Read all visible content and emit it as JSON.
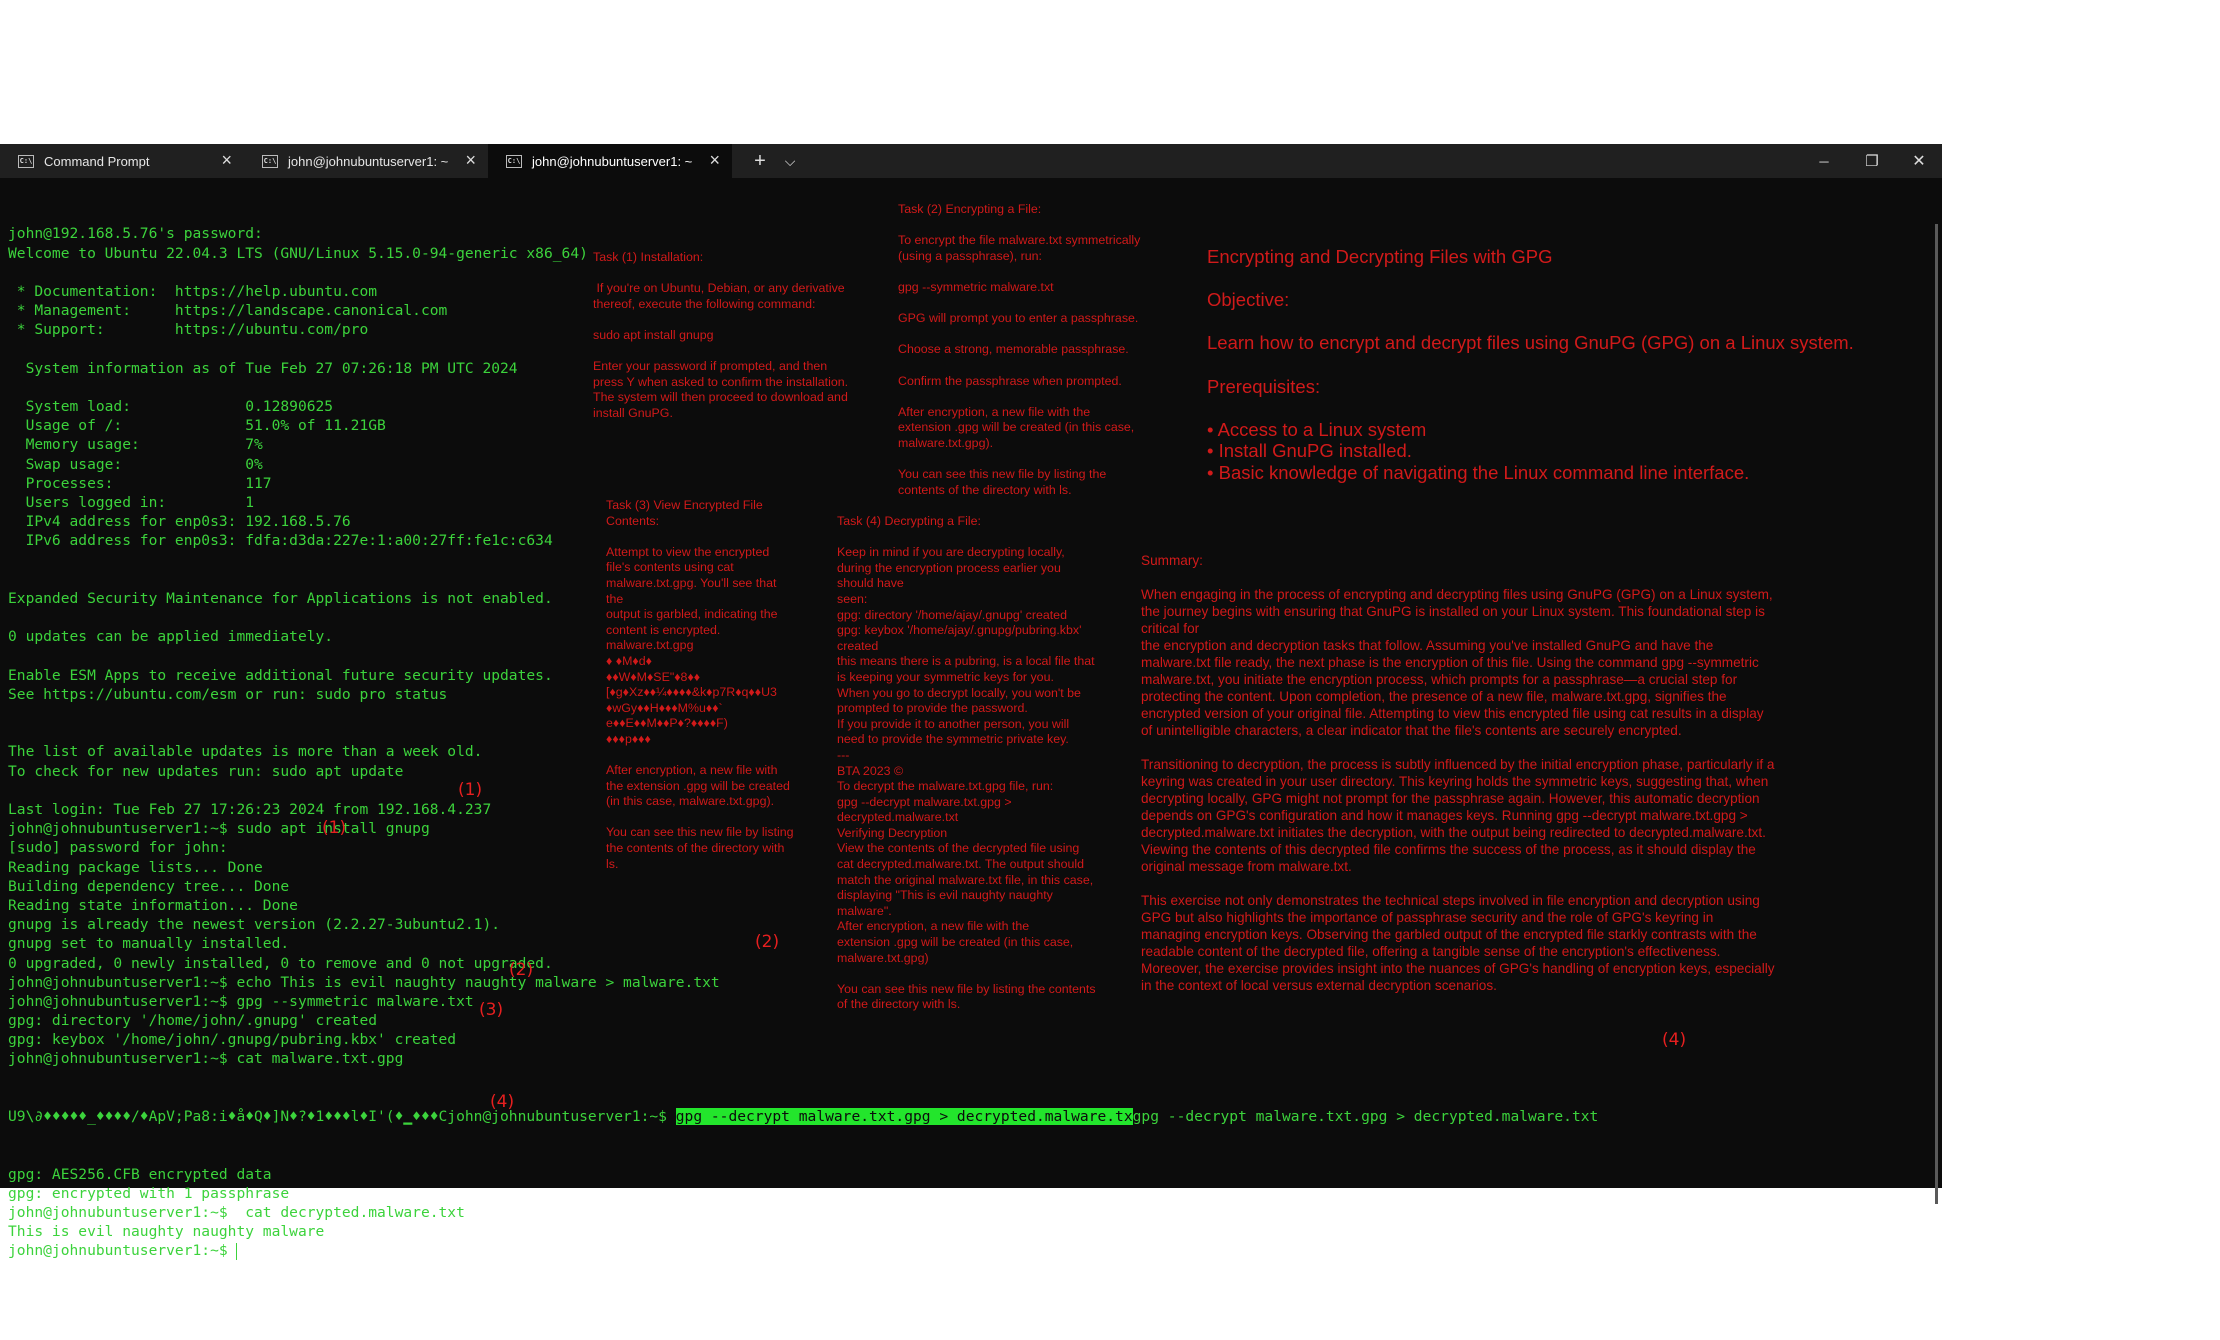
{
  "window": {
    "tabs": [
      {
        "label": "Command Prompt",
        "icon": "cmd-icon"
      },
      {
        "label": "john@johnubuntuserver1: ~",
        "icon": "terminal-icon"
      },
      {
        "label": "john@johnubuntuserver1: ~",
        "icon": "terminal-icon"
      }
    ],
    "new_tab": "+",
    "dropdown": "⌵",
    "minimize": "─",
    "restore": "❐",
    "close": "✕",
    "tab_close": "×"
  },
  "terminal": {
    "lines": [
      "john@192.168.5.76's password:",
      "Welcome to Ubuntu 22.04.3 LTS (GNU/Linux 5.15.0-94-generic x86_64)",
      "",
      " * Documentation:  https://help.ubuntu.com",
      " * Management:     https://landscape.canonical.com",
      " * Support:        https://ubuntu.com/pro",
      "",
      "  System information as of Tue Feb 27 07:26:18 PM UTC 2024",
      "",
      "  System load:             0.12890625",
      "  Usage of /:              51.0% of 11.21GB",
      "  Memory usage:            7%",
      "  Swap usage:              0%",
      "  Processes:               117",
      "  Users logged in:         1",
      "  IPv4 address for enp0s3: 192.168.5.76",
      "  IPv6 address for enp0s3: fdfa:d3da:227e:1:a00:27ff:fe1c:c634",
      "",
      "",
      "Expanded Security Maintenance for Applications is not enabled.",
      "",
      "0 updates can be applied immediately.",
      "",
      "Enable ESM Apps to receive additional future security updates.",
      "See https://ubuntu.com/esm or run: sudo pro status",
      "",
      "",
      "The list of available updates is more than a week old.",
      "To check for new updates run: sudo apt update",
      "",
      "Last login: Tue Feb 27 17:26:23 2024 from 192.168.4.237",
      "john@johnubuntuserver1:~$ sudo apt install gnupg",
      "[sudo] password for john:",
      "Reading package lists... Done",
      "Building dependency tree... Done",
      "Reading state information... Done",
      "gnupg is already the newest version (2.2.27-3ubuntu2.1).",
      "gnupg set to manually installed.",
      "0 upgraded, 0 newly installed, 0 to remove and 0 not upgraded.",
      "john@johnubuntuserver1:~$ echo This is evil naughty naughty malware > malware.txt",
      "john@johnubuntuserver1:~$ gpg --symmetric malware.txt",
      "gpg: directory '/home/john/.gnupg' created",
      "gpg: keybox '/home/john/.gnupg/pubring.kbx' created",
      "john@johnubuntuserver1:~$ cat malware.txt.gpg"
    ],
    "garbled_line": "U9\\∂♦♦♦♦♦_♦♦♦♦/♦ApV;Pa8:i♦å♦Q♦]N♦?♦1♦♦♦l♦I'(♦▁♦♦♦Cjohn@johnubuntuserver1:~$ ",
    "highlighted_cmd": "gpg --decrypt malware.txt.gpg > decrypted.malware.tx",
    "after_highlight": "gpg --decrypt malware.txt.gpg > decrypted.malware.txt",
    "tail_lines": [
      "gpg: AES256.CFB encrypted data",
      "gpg: encrypted with 1 passphrase",
      "john@johnubuntuserver1:~$  cat decrypted.malware.txt",
      "This is evil naughty naughty malware",
      "john@johnubuntuserver1:~$ "
    ]
  },
  "annotations": {
    "a1": "(1)",
    "a2": "(1)",
    "a3": "(2)",
    "a4": "(2)",
    "a5": "(3)",
    "a6": "(4)",
    "a7": "(4)"
  },
  "notes": {
    "task1": "Task (1) Installation:\n\n If you're on Ubuntu, Debian, or any derivative\nthereof, execute the following command:\n\nsudo apt install gnupg\n\nEnter your password if prompted, and then\npress Y when asked to confirm the installation.\nThe system will then proceed to download and\ninstall GnuPG.",
    "task2": "Task (2) Encrypting a File:\n\nTo encrypt the file malware.txt symmetrically\n(using a passphrase), run:\n\ngpg --symmetric malware.txt\n\nGPG will prompt you to enter a passphrase.\n\nChoose a strong, memorable passphrase.\n\nConfirm the passphrase when prompted.\n\nAfter encryption, a new file with the\nextension .gpg will be created (in this case,\nmalware.txt.gpg).\n\nYou can see this new file by listing the\ncontents of the directory with ls.",
    "task3": "Task (3) View Encrypted File\nContents:\n\nAttempt to view the encrypted\nfile's contents using cat\nmalware.txt.gpg. You'll see that\nthe\noutput is garbled, indicating the\ncontent is encrypted.\nmalware.txt.gpg\n♦ ♦M♦d♦\n♦♦W♦M♦SE\"♦8♦♦\n[♦g♦Xz♦♦¼♦♦♦♦&k♦p7R♦q♦♦U3\n♦wGy♦♦H♦♦♦M%u♦♦`\ne♦♦E♦♦M♦♦P♦?♦♦♦♦F)\n♦♦♦p♦♦♦\n\nAfter encryption, a new file with\nthe extension .gpg will be created\n(in this case, malware.txt.gpg).\n\nYou can see this new file by listing\nthe contents of the directory with\nls.",
    "task4": "Task (4) Decrypting a File:\n\nKeep in mind if you are decrypting locally,\nduring the encryption process earlier you\nshould have\nseen:\ngpg: directory '/home/ajay/.gnupg' created\ngpg: keybox '/home/ajay/.gnupg/pubring.kbx'\ncreated\nthis means there is a pubring, is a local file that\nis keeping your symmetric keys for you.\nWhen you go to decrypt locally, you won't be\nprompted to provide the password.\nIf you provide it to another person, you will\nneed to provide the symmetric private key.\n---\nBTA 2023 ©\nTo decrypt the malware.txt.gpg file, run:\ngpg --decrypt malware.txt.gpg >\ndecrypted.malware.txt\nVerifying Decryption\nView the contents of the decrypted file using\ncat decrypted.malware.txt. The output should\nmatch the original malware.txt file, in this case,\ndisplaying \"This is evil naughty naughty\nmalware\".\nAfter encryption, a new file with the\nextension .gpg will be created (in this case,\nmalware.txt.gpg)\n\nYou can see this new file by listing the contents\nof the directory with ls.",
    "heading": "Encrypting and Decrypting Files with GPG\n\nObjective:\n\nLearn how to encrypt and decrypt files using GnuPG (GPG) on a Linux system.\n\nPrerequisites:\n\n• Access to a Linux system\n• Install GnuPG installed.\n• Basic knowledge of navigating the Linux command line interface.",
    "summary": "Summary:\n\nWhen engaging in the process of encrypting and decrypting files using GnuPG (GPG) on a Linux system,\nthe journey begins with ensuring that GnuPG is installed on your Linux system. This foundational step is\ncritical for\nthe encryption and decryption tasks that follow. Assuming you've installed GnuPG and have the\nmalware.txt file ready, the next phase is the encryption of this file. Using the command gpg --symmetric\nmalware.txt, you initiate the encryption process, which prompts for a passphrase—a crucial step for\nprotecting the content. Upon completion, the presence of a new file, malware.txt.gpg, signifies the\nencrypted version of your original file. Attempting to view this encrypted file using cat results in a display\nof unintelligible characters, a clear indicator that the file's contents are securely encrypted.\n\nTransitioning to decryption, the process is subtly influenced by the initial encryption phase, particularly if a\nkeyring was created in your user directory. This keyring holds the symmetric keys, suggesting that, when\ndecrypting locally, GPG might not prompt for the passphrase again. However, this automatic decryption\ndepends on GPG's configuration and how it manages keys. Running gpg --decrypt malware.txt.gpg >\ndecrypted.malware.txt initiates the decryption, with the output being redirected to decrypted.malware.txt.\nViewing the contents of this decrypted file confirms the success of the process, as it should display the\noriginal message from malware.txt.\n\nThis exercise not only demonstrates the technical steps involved in file encryption and decryption using\nGPG but also highlights the importance of passphrase security and the role of GPG's keyring in\nmanaging encryption keys. Observing the garbled output of the encrypted file starkly contrasts with the\nreadable content of the decrypted file, offering a tangible sense of the encryption's effectiveness.\nMoreover, the exercise provides insight into the nuances of GPG's handling of encryption keys, especially\nin the context of local versus external decryption scenarios."
  },
  "colors": {
    "terminal_bg": "#0c0c0c",
    "terminal_text": "#3cd33c",
    "annotation_red": "#e61f1f",
    "highlight": "#23e52c"
  }
}
